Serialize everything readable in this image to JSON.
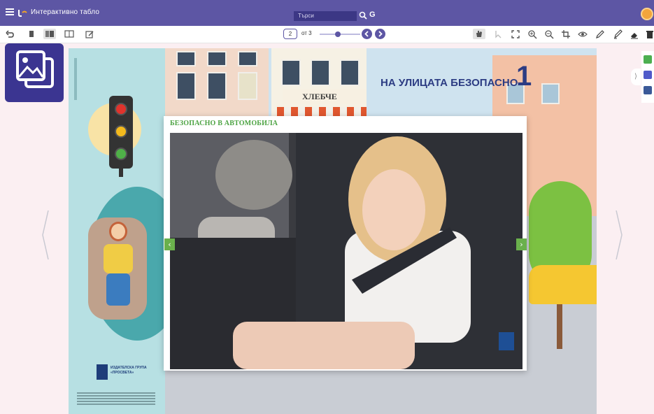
{
  "app": {
    "title": "Интерактивно табло",
    "search_placeholder": "Търси",
    "brand_color": "#5d56a4"
  },
  "toolbar": {
    "current_page": "2",
    "page_of": "от 3",
    "zoom_level": 0.45,
    "icons": [
      "undo-icon",
      "single-page-icon",
      "double-page-icon",
      "spread-icon",
      "edit-icon",
      "hand-icon",
      "pointer-icon",
      "fullscreen-icon",
      "zoom-in-icon",
      "zoom-out-icon",
      "crop-icon",
      "eye-icon",
      "pen-icon",
      "marker-icon",
      "eraser-icon",
      "trash-icon"
    ]
  },
  "book": {
    "left_page": {
      "publisher": "ИЗДАТЕЛСКА ГРУПА «ПРОСВЕТА»"
    },
    "right_page": {
      "heading": "НА УЛИЦАТА БЕЗОПАСНО",
      "lesson_number": "1",
      "shop_sign": "ХЛЕБЧЕ"
    }
  },
  "popup": {
    "title": "БЕЗОПАСНО В АВТОМОБИЛА",
    "prev_label": "‹",
    "next_label": "›"
  },
  "right_rail": {
    "collapse_label": "⟩"
  }
}
